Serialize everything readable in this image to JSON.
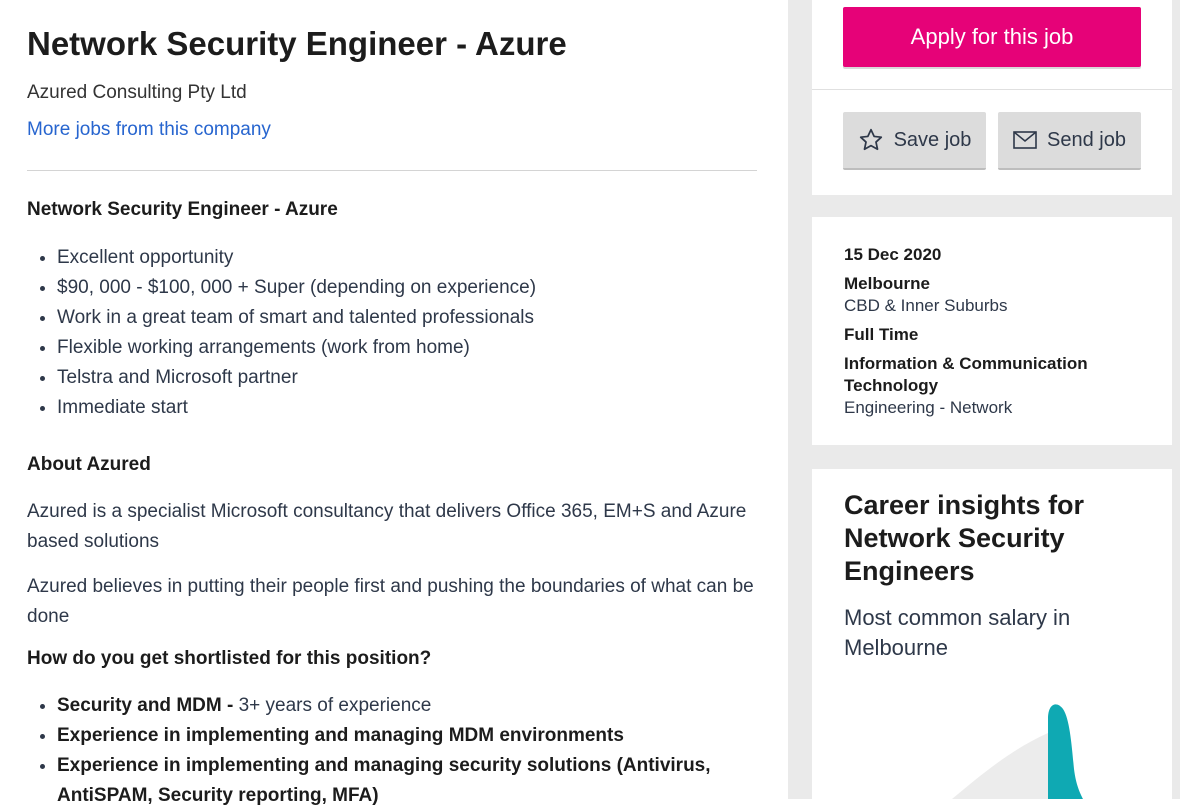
{
  "job": {
    "title": "Network Security Engineer - Azure",
    "company": "Azured Consulting Pty Ltd",
    "more_jobs_link": "More jobs from this company"
  },
  "description": {
    "heading": "Network Security Engineer - Azure",
    "highlights": [
      "Excellent opportunity",
      "$90, 000 - $100, 000 + Super (depending on experience)",
      "Work in a great team of smart and talented professionals",
      "Flexible working arrangements (work from home)",
      "Telstra and Microsoft partner",
      "Immediate start"
    ],
    "about_heading": "About Azured",
    "about_paragraphs": [
      "Azured is a specialist Microsoft consultancy that delivers Office 365, EM+S and Azure based solutions",
      "Azured believes in putting their people first and pushing the boundaries of what can be done"
    ],
    "shortlist_heading": "How do you get shortlisted for this position?",
    "requirements": [
      {
        "bold": "Security and MDM - ",
        "text": "3+ years of experience"
      },
      {
        "bold": "Experience in implementing and managing MDM environments",
        "text": ""
      },
      {
        "bold": "Experience in implementing and managing security solutions (Antivirus, AntiSPAM, Security reporting, MFA)",
        "text": ""
      }
    ]
  },
  "actions": {
    "apply_label": "Apply for this job",
    "save_label": "Save job",
    "send_label": "Send job",
    "apply_color": "#e60278"
  },
  "details": {
    "date": "15 Dec 2020",
    "location": "Melbourne",
    "area": "CBD & Inner Suburbs",
    "work_type": "Full Time",
    "classification": "Information & Communication Technology",
    "sub_classification": "Engineering - Network"
  },
  "insights": {
    "title": "Career insights for Network Security Engineers",
    "subtitle": "Most common salary in Melbourne",
    "chart_color": "#0fa9b3"
  }
}
